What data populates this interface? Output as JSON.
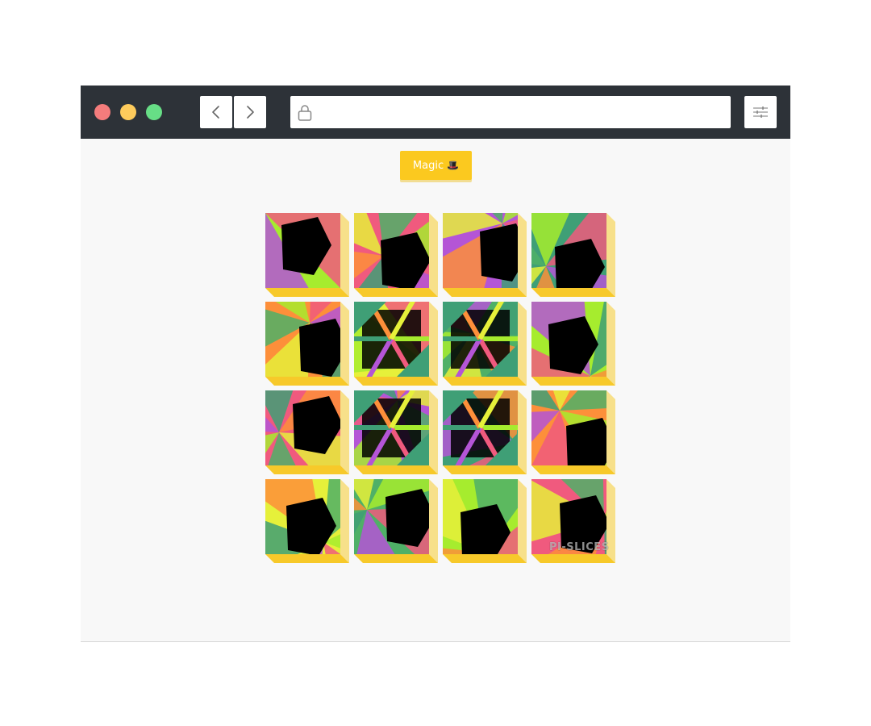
{
  "browser": {
    "traffic_lights": [
      "#f47c7c",
      "#fdcb5c",
      "#67de86"
    ],
    "toolbar_color": "#2d3238",
    "back_icon": "chevron-left-icon",
    "forward_icon": "chevron-right-icon",
    "address_icon": "lock-icon",
    "address_value": "",
    "settings_icon": "sliders-icon"
  },
  "app": {
    "magic_button_label": "Magic",
    "magic_button_icon": "🎩",
    "accent_color": "#fbc91f",
    "watermark": "PI-SLICES",
    "grid": {
      "rows": 4,
      "cols": 4
    }
  }
}
